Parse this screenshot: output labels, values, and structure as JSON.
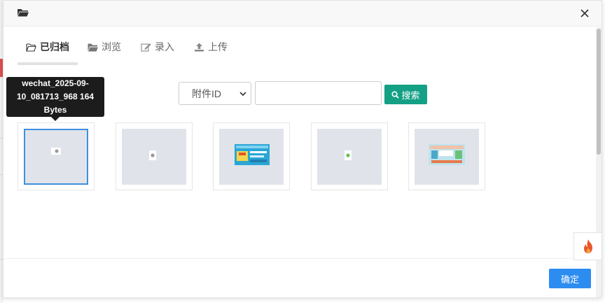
{
  "header": {
    "icon": "folder-open-icon",
    "close_icon": "close-icon"
  },
  "tabs": [
    {
      "label": "已归档",
      "icon": "folder-outline-icon",
      "active": true
    },
    {
      "label": "浏览",
      "icon": "folder-open-icon",
      "active": false
    },
    {
      "label": "录入",
      "icon": "edit-icon",
      "active": false
    },
    {
      "label": "上传",
      "icon": "upload-icon",
      "active": false
    }
  ],
  "tooltip": {
    "lines": [
      "wechat_2025-09-",
      "10_081713_968  164",
      "Bytes"
    ]
  },
  "search": {
    "select_value": "附件ID",
    "input_value": "",
    "button_label": "搜索"
  },
  "footer": {
    "ok_label": "确定"
  },
  "colors": {
    "accent_green": "#14a085",
    "primary_blue": "#2d8cf0",
    "selected_border": "#3d8fe0",
    "fire": "#e8572a"
  }
}
